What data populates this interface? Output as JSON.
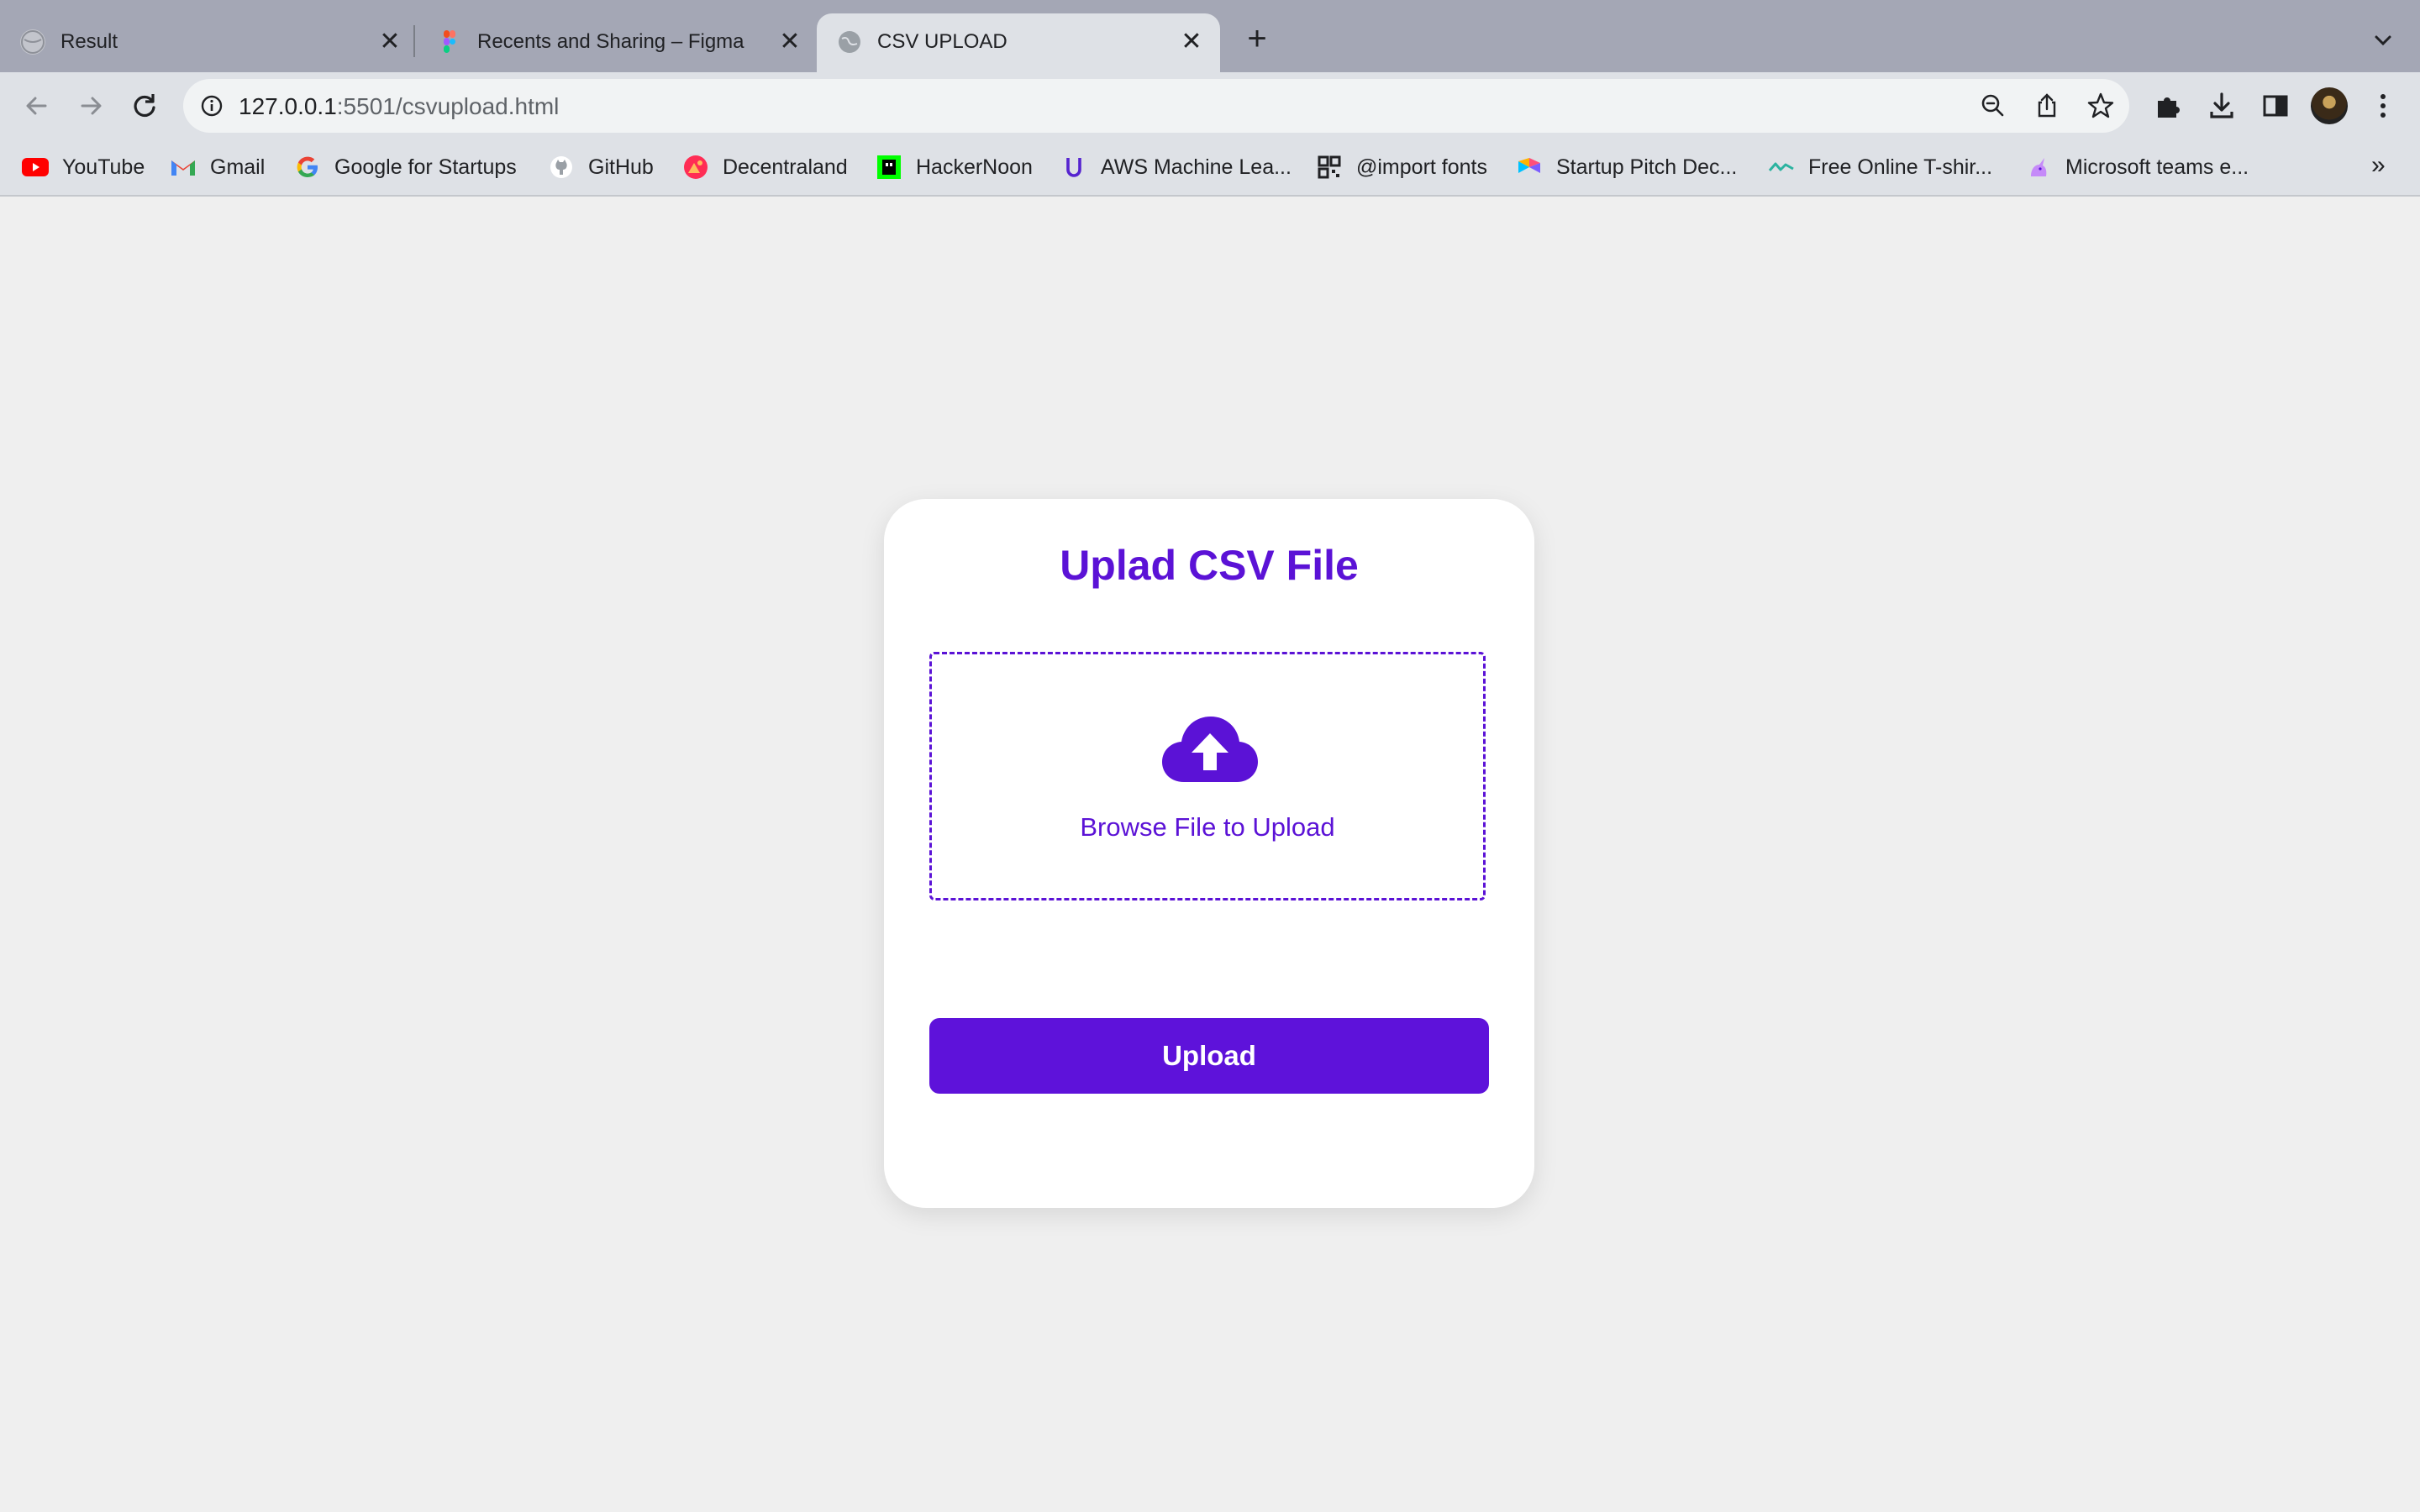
{
  "browser": {
    "tabs": [
      {
        "title": "Result",
        "close": "✕"
      },
      {
        "title": "Recents and Sharing – Figma",
        "close": "✕"
      },
      {
        "title": "CSV UPLOAD",
        "close": "✕"
      }
    ],
    "new_tab": "+",
    "url_host": "127.0.0.1",
    "url_rest": ":5501/csvupload.html",
    "bookmarks": [
      {
        "label": "YouTube",
        "icon": "youtube-icon"
      },
      {
        "label": "Gmail",
        "icon": "gmail-icon"
      },
      {
        "label": "Google for Startups",
        "icon": "google-icon"
      },
      {
        "label": "GitHub",
        "icon": "github-icon"
      },
      {
        "label": "Decentraland",
        "icon": "decentraland-icon"
      },
      {
        "label": "HackerNoon",
        "icon": "hackernoon-icon"
      },
      {
        "label": "AWS Machine Lea...",
        "icon": "udemy-icon"
      },
      {
        "label": "@import fonts",
        "icon": "qr-icon"
      },
      {
        "label": "Startup Pitch Dec...",
        "icon": "pitch-icon"
      },
      {
        "label": "Free Online T-shir...",
        "icon": "wave-icon"
      },
      {
        "label": "Microsoft teams e...",
        "icon": "unicorn-icon"
      }
    ],
    "bookmarks_more": "»"
  },
  "page": {
    "title": "Uplad CSV File",
    "browse_label": "Browse File to Upload",
    "upload_button": "Upload",
    "accent_color": "#5b12d6",
    "background_color": "#efefef"
  }
}
